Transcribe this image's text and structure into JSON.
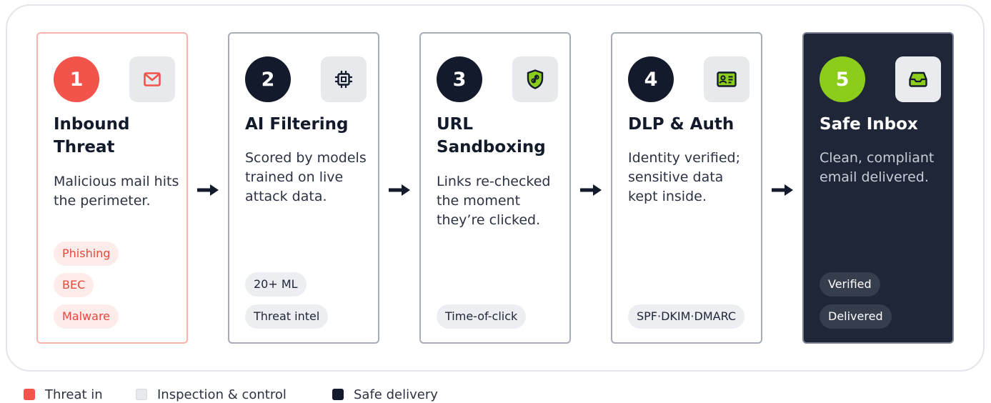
{
  "steps": [
    {
      "number": "1",
      "title": "Inbound Threat",
      "description": "Malicious mail hits the perimeter.",
      "tags": [
        "Phishing",
        "BEC",
        "Malware"
      ],
      "icon": "envelope-icon"
    },
    {
      "number": "2",
      "title": "AI Filtering",
      "description": "Scored by models trained on live attack data.",
      "tags": [
        "20+ ML",
        "Threat intel"
      ],
      "icon": "chip-icon"
    },
    {
      "number": "3",
      "title": "URL Sandboxing",
      "description": "Links re-checked the moment they’re clicked.",
      "tags": [
        "Time-of-click"
      ],
      "icon": "shield-link-icon"
    },
    {
      "number": "4",
      "title": "DLP & Auth",
      "description": "Identity verified; sensitive data kept inside.",
      "tags": [
        "SPF·DKIM·DMARC"
      ],
      "icon": "id-card-icon"
    },
    {
      "number": "5",
      "title": "Safe Inbox",
      "description": "Clean, compliant email delivered.",
      "tags": [
        "Verified",
        "Delivered"
      ],
      "icon": "inbox-icon"
    }
  ],
  "legend": [
    {
      "label": "Threat in",
      "color": "#f2534a"
    },
    {
      "label": "Inspection & control",
      "color": "#e7e9ed"
    },
    {
      "label": "Safe delivery",
      "color": "#121a2b"
    }
  ],
  "colors": {
    "threat_accent": "#f2534a",
    "inspection_fill": "#e7e9ed",
    "safe_fill": "#1f2637",
    "safe_accent": "#8ccc1b"
  }
}
